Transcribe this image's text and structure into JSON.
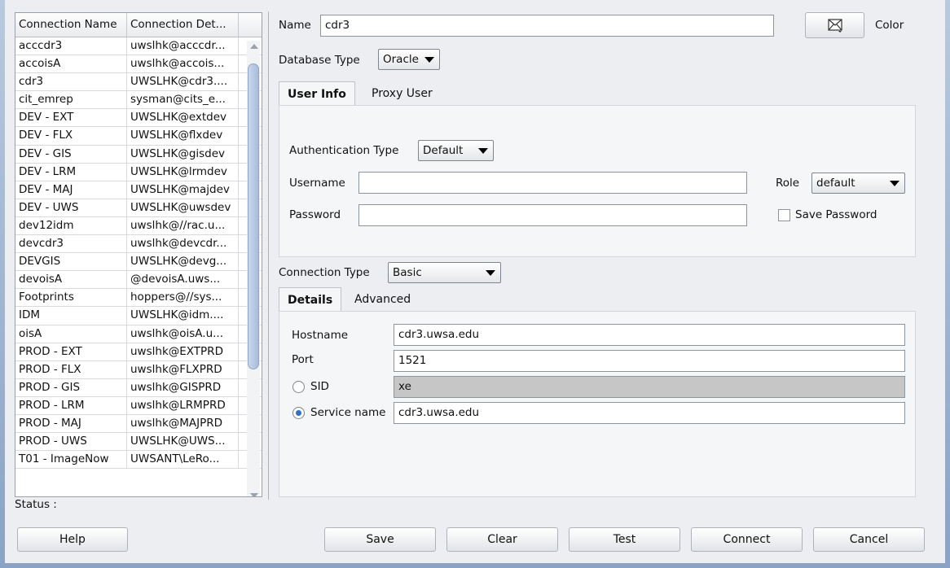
{
  "connections": {
    "headers": [
      "Connection Name",
      "Connection Det..."
    ],
    "rows": [
      {
        "name": "acccdr3",
        "details": "uwslhk@acccdr..."
      },
      {
        "name": "accoisA",
        "details": "uwslhk@accois..."
      },
      {
        "name": "cdr3",
        "details": "UWSLHK@cdr3...."
      },
      {
        "name": "cit_emrep",
        "details": "sysman@cits_e..."
      },
      {
        "name": "DEV - EXT",
        "details": "UWSLHK@extdev"
      },
      {
        "name": "DEV - FLX",
        "details": "UWSLHK@flxdev"
      },
      {
        "name": "DEV - GIS",
        "details": "UWSLHK@gisdev"
      },
      {
        "name": "DEV - LRM",
        "details": "UWSLHK@lrmdev"
      },
      {
        "name": "DEV - MAJ",
        "details": "UWSLHK@majdev"
      },
      {
        "name": "DEV - UWS",
        "details": "UWSLHK@uwsdev"
      },
      {
        "name": "dev12idm",
        "details": "uwslhk@//rac.u..."
      },
      {
        "name": "devcdr3",
        "details": "uwslhk@devcdr..."
      },
      {
        "name": "DEVGIS",
        "details": "UWSLHK@devg..."
      },
      {
        "name": "devoisA",
        "details": "@devoisA.uws..."
      },
      {
        "name": "Footprints",
        "details": "hoppers@//sys..."
      },
      {
        "name": "IDM",
        "details": "UWSLHK@idm...."
      },
      {
        "name": "oisA",
        "details": "uwslhk@oisA.u..."
      },
      {
        "name": "PROD - EXT",
        "details": "uwslhk@EXTPRD"
      },
      {
        "name": "PROD - FLX",
        "details": "uwslhk@FLXPRD"
      },
      {
        "name": "PROD - GIS",
        "details": "uwslhk@GISPRD"
      },
      {
        "name": "PROD - LRM",
        "details": "uwslhk@LRMPRD"
      },
      {
        "name": "PROD - MAJ",
        "details": "uwslhk@MAJPRD"
      },
      {
        "name": "PROD - UWS",
        "details": "UWSLHK@UWS..."
      },
      {
        "name": "T01 - ImageNow",
        "details": "UWSANT\\LeRo..."
      }
    ]
  },
  "status_label": "Status :",
  "form": {
    "name_label": "Name",
    "name_value": "cdr3",
    "color_label": "Color",
    "db_type_label": "Database Type",
    "db_type_value": "Oracle",
    "tabs": [
      "User Info",
      "Proxy User"
    ],
    "auth_type_label": "Authentication Type",
    "auth_type_value": "Default",
    "username_label": "Username",
    "username_value": "",
    "password_label": "Password",
    "password_value": "",
    "role_label": "Role",
    "role_value": "default",
    "save_password_label": "Save Password",
    "conn_type_label": "Connection Type",
    "conn_type_value": "Basic",
    "detail_tabs": [
      "Details",
      "Advanced"
    ],
    "hostname_label": "Hostname",
    "hostname_value": "cdr3.uwsa.edu",
    "port_label": "Port",
    "port_value": "1521",
    "sid_label": "SID",
    "sid_value": "xe",
    "service_label": "Service name",
    "service_value": "cdr3.uwsa.edu"
  },
  "buttons": {
    "help": "Help",
    "save": "Save",
    "clear": "Clear",
    "test": "Test",
    "connect": "Connect",
    "cancel": "Cancel"
  }
}
